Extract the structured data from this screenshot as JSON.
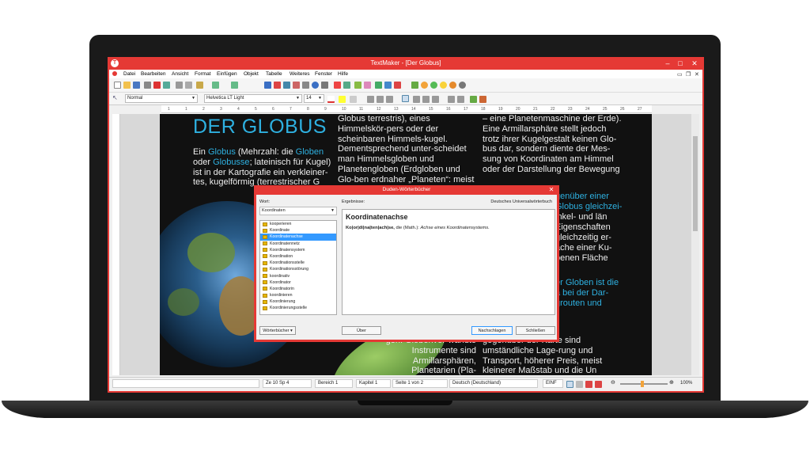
{
  "window": {
    "title": "TextMaker - [Der Globus]"
  },
  "menu": [
    "Datei",
    "Bearbeiten",
    "Ansicht",
    "Format",
    "Einfügen",
    "Objekt",
    "Tabelle",
    "Weiteres",
    "Fenster",
    "Hilfe"
  ],
  "format_bar": {
    "style": "Normal",
    "font": "Helvetica LT Light",
    "size": "14"
  },
  "ruler_marks": [
    "1",
    "1",
    "2",
    "3",
    "4",
    "5",
    "6",
    "7",
    "8",
    "9",
    "10",
    "11",
    "12",
    "13",
    "14",
    "15",
    "16",
    "17",
    "18",
    "19",
    "20",
    "21",
    "22",
    "23",
    "24",
    "25",
    "26",
    "27"
  ],
  "document": {
    "title": "DER GLOBUS",
    "col1": {
      "pre": "Ein ",
      "link1": "Globus",
      "mid1": " (Mehrzahl: die ",
      "link2": "Globen",
      "mid2": " oder ",
      "link3": "Globusse",
      "rest": "; lateinisch für Kugel) ist in der Kartografie ein verkleiner-tes, kugelförmig (terrestrischer G"
    },
    "col2": {
      "top": "Globus terrestris), eines Himmelskör-pers oder der scheinbaren Himmels-kugel. Dementsprechend unter-scheidet man Himmelsgloben und Planetengloben (Erdgloben und Glo-ben erdnaher „Planeten“: meist",
      "bottom": "gen. Globenver-wandte Instrumente sind Armillarsphären, Planetarien (Pla-"
    },
    "col3": {
      "top": "– eine Planetenmaschine der Erde). Eine Armillarsphäre stellt jedoch trotz ihrer Kugelgestalt keinen Glo-bus dar, sondern diente der Mes-sung von Koordinaten am Himmel oder der Darstellung der Bewegung",
      "mid1": "genüber einer",
      "mid2": "Globus gleichzei-",
      "mid3": "inkel- und län",
      "mid4": "Eigenschaften",
      "mid5": "gleichzeitig er-",
      "mid6": "ache einer Ku-",
      "mid7": "benen Fläche",
      "blue1": "er Globen ist die",
      "blue2": "a bei der Dar-",
      "blue3": "grouten und",
      "bottom": "gegenüber der Karte sind umständliche Lage-rung und Transport, höherer Preis, meist kleinerer Maßstab und die Un"
    }
  },
  "dialog": {
    "title": "Duden-Wörterbücher",
    "word_label": "Wort:",
    "word_value": "Koordinaten",
    "results_label": "Ergebnisse:",
    "source": "Deutsches Universalwörterbuch",
    "headword": "Koordinatenachse",
    "entry_bold": "Ko|or|di|na|ten|ach|se,",
    "entry_mid": " die ",
    "entry_gram": "(Math.): ",
    "entry_def": "Achse eines Koordinatensystems.",
    "words": [
      "kooperieren",
      "Koordinate",
      "Koordinatenachse",
      "Koordinatennetz",
      "Koordinatensystem",
      "Koordination",
      "Koordinationsstelle",
      "Koordinationsstörung",
      "koordinativ",
      "Koordinator",
      "Koordinatorin",
      "koordinieren",
      "Koordinierung",
      "Koordinierungsstelle"
    ],
    "selected_index": 2,
    "btn_dict": "Wörterbücher ▾",
    "btn_apply": "Über",
    "btn_lookup": "Nachschlagen",
    "btn_close": "Schließen"
  },
  "status": {
    "pos": "Ze 10 Sp 4",
    "area": "Bereich 1",
    "chapter": "Kapitel 1",
    "page": "Seite 1 von 2",
    "lang": "Deutsch (Deutschland)",
    "mode": "EINF",
    "zoom": "100%"
  },
  "colors": {
    "accent": "#e53935",
    "link": "#2eb0e0",
    "selection": "#3399ff"
  }
}
